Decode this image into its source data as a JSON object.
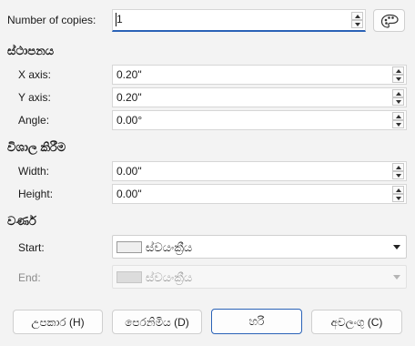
{
  "copies": {
    "label": "Number of copies:",
    "value": "1"
  },
  "placement": {
    "heading": "ස්ථාපනය",
    "x_label": "X axis:",
    "x_value": "0.20\"",
    "y_label": "Y axis:",
    "y_value": "0.20\"",
    "angle_label": "Angle:",
    "angle_value": "0.00°"
  },
  "enlargement": {
    "heading": "විශාල කිරීම",
    "width_label": "Width:",
    "width_value": "0.00\"",
    "height_label": "Height:",
    "height_value": "0.00\""
  },
  "colors": {
    "heading": "වර්ණ",
    "start_label": "Start:",
    "start_value": "ස්වයංක්‍රීය",
    "end_label": "End:",
    "end_value": "ස්වයංක්‍රීය"
  },
  "buttons": {
    "help": "උපකාර (H)",
    "reset": "පෙරනිමිය (D)",
    "ok": "හරි",
    "cancel": "අවලංගු (C)"
  },
  "icons": {
    "palette": "palette-icon"
  },
  "accent_color": "#2a62b7"
}
